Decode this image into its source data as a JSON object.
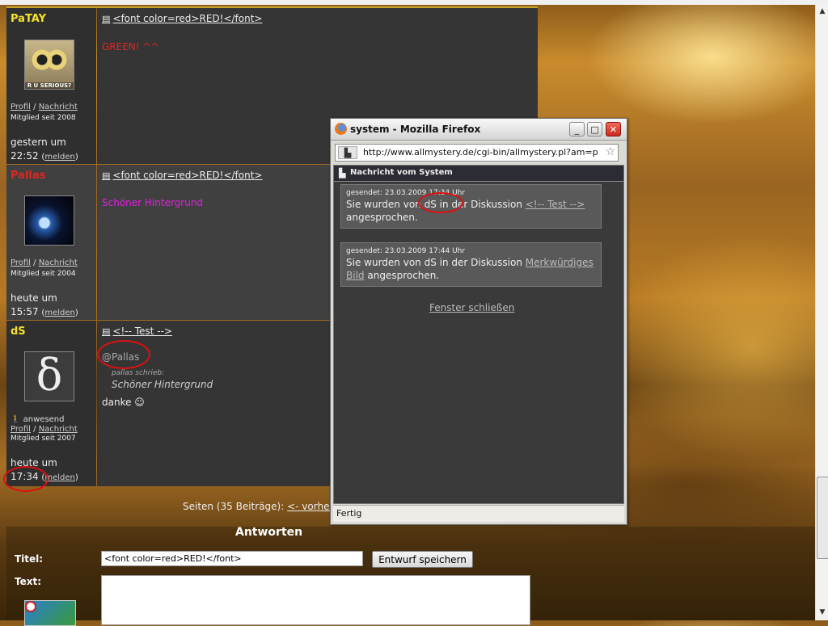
{
  "posts": [
    {
      "username": "PaTAY",
      "username_color": "#f5e22a",
      "avatar_caption": "R U SERIOUS?",
      "profile_label": "Profil",
      "message_label": "Nachricht",
      "member_since": "Mitglied seit 2008",
      "time_day": "gestern um",
      "time_clock": "22:52",
      "report_label": "melden",
      "title": "<font color=red>RED!</font>",
      "body": "GREEN! ^^"
    },
    {
      "username": "Pallas",
      "username_color": "#e0261e",
      "profile_label": "Profil",
      "message_label": "Nachricht",
      "member_since": "Mitglied seit 2004",
      "time_day": "heute um",
      "time_clock": "15:57",
      "report_label": "melden",
      "title": "<font color=red>RED!</font>",
      "body": "Schöner Hintergrund"
    },
    {
      "username": "dS",
      "username_color": "#f5e22a",
      "status": "anwesend",
      "profile_label": "Profil",
      "message_label": "Nachricht",
      "member_since": "Mitglied seit 2007",
      "time_day": "heute um",
      "time_clock": "17:34",
      "report_label": "melden",
      "title": "<!-- Test -->",
      "mention": "@Pallas",
      "quote_author": "pallas schrieb:",
      "quote_text": "Schöner Hintergrund",
      "body": "danke ☺"
    }
  ],
  "pagination": {
    "label": "Seiten (35 Beiträge):",
    "prev": "<- vorher"
  },
  "reply": {
    "heading": "Antworten",
    "title_label": "Titel:",
    "title_value": "<font color=red>RED!</font>",
    "draft_button": "Entwurf speichern",
    "text_label": "Text:"
  },
  "popup": {
    "window_title": "system - Mozilla Firefox",
    "url": "http://www.allmystery.de/cgi-bin/allmystery.pl?am=pn&amp",
    "header": "Nachricht vom System",
    "messages": [
      {
        "sent_prefix": "gesendet: 23.03.2009",
        "sent_time": "17:34 Uhr",
        "text_before": "Sie wurden von dS in der Diskussion",
        "link": "<!-- Test -->",
        "text_after": "angesprochen."
      },
      {
        "sent_prefix": "gesendet: 23.03.2009",
        "sent_time": "17:44 Uhr",
        "text_before": "Sie wurden von dS in der Diskussion",
        "link": "Merkwürdiges Bild",
        "text_after": "angesprochen."
      }
    ],
    "close_link": "Fenster schließen",
    "status": "Fertig"
  },
  "colors": {
    "green_text": "#e0261e",
    "pink_text": "#e020e0",
    "mention_circle": "#dd1111"
  }
}
